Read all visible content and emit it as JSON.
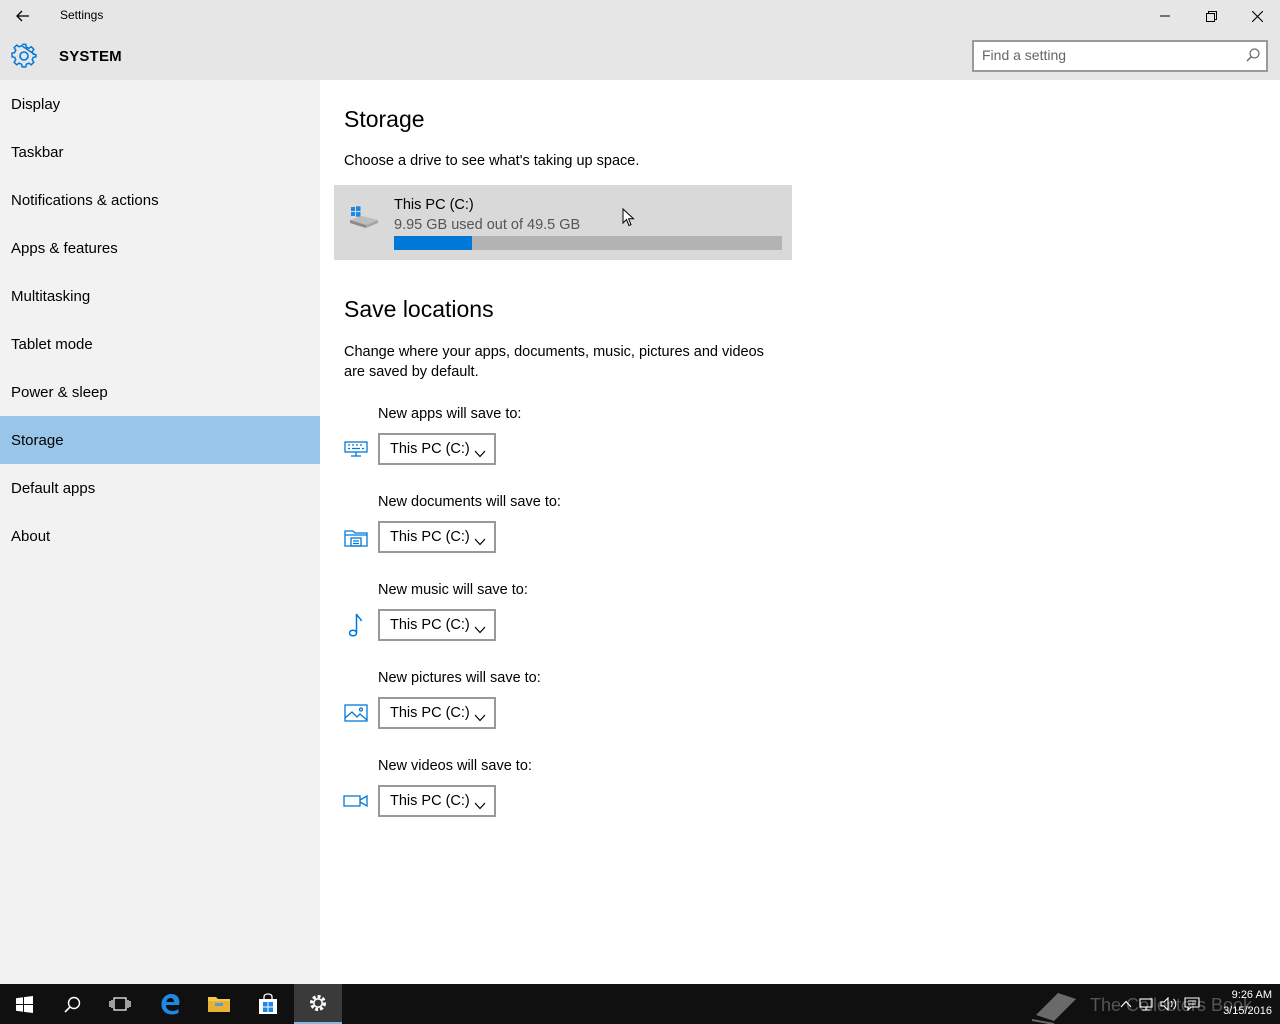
{
  "titlebar": {
    "title": "Settings"
  },
  "header": {
    "title": "SYSTEM",
    "search_placeholder": "Find a setting"
  },
  "sidebar": {
    "items": [
      {
        "label": "Display"
      },
      {
        "label": "Taskbar"
      },
      {
        "label": "Notifications & actions"
      },
      {
        "label": "Apps & features"
      },
      {
        "label": "Multitasking"
      },
      {
        "label": "Tablet mode"
      },
      {
        "label": "Power & sleep"
      },
      {
        "label": "Storage"
      },
      {
        "label": "Default apps"
      },
      {
        "label": "About"
      }
    ],
    "selected": "Storage"
  },
  "storage": {
    "title": "Storage",
    "description": "Choose a drive to see what's taking up space.",
    "drive": {
      "name": "This PC (C:)",
      "usage": "9.95 GB used out of 49.5 GB",
      "used_fraction": 0.201
    }
  },
  "save_locations": {
    "title": "Save locations",
    "description_line1": "Change where your apps, documents, music, pictures and videos",
    "description_line2": "are saved by default.",
    "items": [
      {
        "label": "New apps will save to:",
        "value": "This PC (C:)",
        "icon": "keyboard-icon"
      },
      {
        "label": "New documents will save to:",
        "value": "This PC (C:)",
        "icon": "document-folder-icon"
      },
      {
        "label": "New music will save to:",
        "value": "This PC (C:)",
        "icon": "music-note-icon"
      },
      {
        "label": "New pictures will save to:",
        "value": "This PC (C:)",
        "icon": "picture-icon"
      },
      {
        "label": "New videos will save to:",
        "value": "This PC (C:)",
        "icon": "video-camera-icon"
      }
    ]
  },
  "taskbar": {
    "watermark": "The Collectors Book",
    "time": "9:26 AM",
    "date": "3/15/2016"
  },
  "colors": {
    "accent": "#0078d7",
    "selection": "#99c5e8",
    "sidebar_bg": "#f2f2f2",
    "titlebar_bg": "#e6e6e6"
  }
}
